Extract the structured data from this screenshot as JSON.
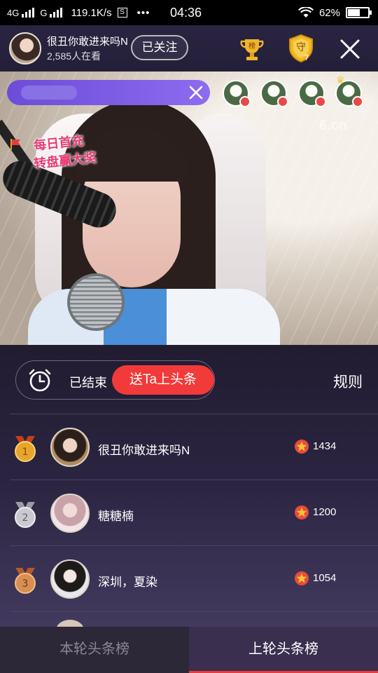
{
  "status_bar": {
    "network_1": "4G",
    "network_2": "G",
    "speed": "119.1K/s",
    "s_icon_text": "S",
    "dots": "•••",
    "time": "04:36",
    "battery": "62%",
    "battery_level": 0.62
  },
  "header": {
    "anchor_name": "很丑你敢进来吗N",
    "viewers": "2,585人在看",
    "follow_label": "已关注",
    "trophy_text": "榜",
    "shield_text": "守",
    "shield_count": "7"
  },
  "video": {
    "watermark": "6.cn",
    "promo_line1": "每日首充",
    "promo_line2": "转盘赢大奖"
  },
  "board": {
    "status": "已结束",
    "send_button": "送Ta上头条",
    "rules": "规则",
    "rows": [
      {
        "rank": "1",
        "name": "很丑你敢进来吗N",
        "score": "1434"
      },
      {
        "rank": "2",
        "name": "糖糖楠",
        "score": "1200"
      },
      {
        "rank": "3",
        "name": "深圳，夏染",
        "score": "1054"
      }
    ]
  },
  "tabs": {
    "current_round": "本轮头条榜",
    "last_round": "上轮头条榜"
  },
  "colors": {
    "accent_red": "#f23a3a",
    "medal_gold": "#e7a52d",
    "medal_silver": "#c9c9cf",
    "medal_bronze": "#d88f52",
    "banner_purple": "#7a5ae4"
  }
}
